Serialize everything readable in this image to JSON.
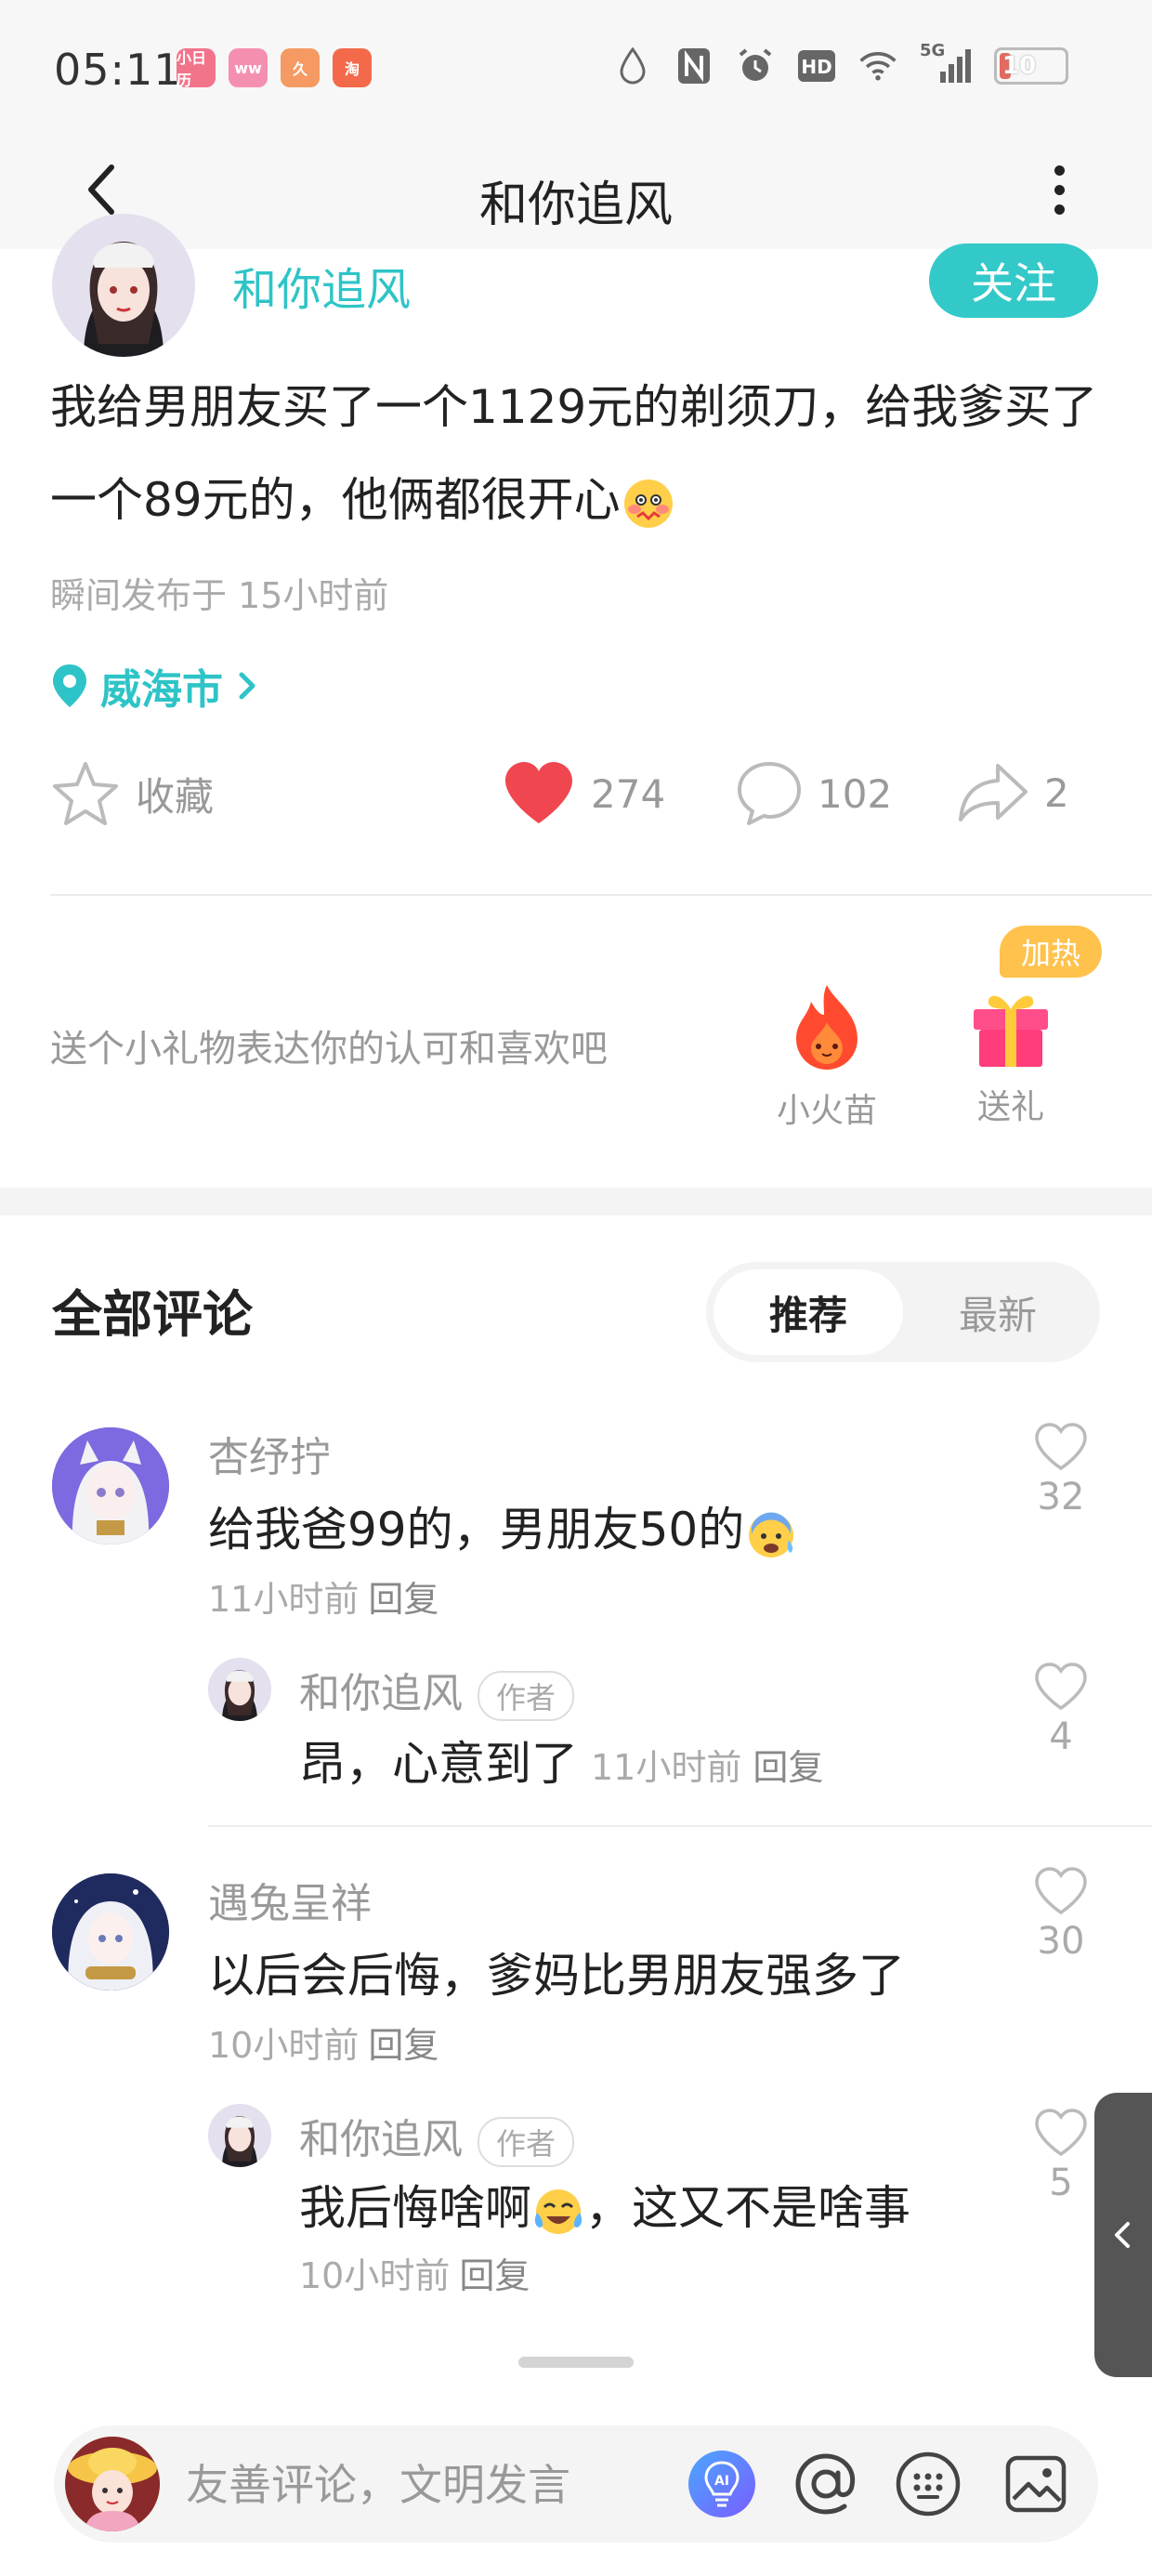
{
  "status_bar": {
    "time": "05:11",
    "apps": [
      {
        "label": "小日历",
        "color": "#f2748b"
      },
      {
        "label": "ww",
        "color": "#f58fb0"
      },
      {
        "label": "久",
        "color": "#f59a63"
      },
      {
        "label": "淘",
        "color": "#f3694a"
      }
    ],
    "network": "5G",
    "battery": "10"
  },
  "nav": {
    "title": "和你追风"
  },
  "post": {
    "author": "和你追风",
    "follow_label": "关注",
    "text": "我给男朋友买了一个1129元的剃须刀，给我爹买了一个89元的，他俩都很开心",
    "time": "瞬间发布于 15小时前",
    "location": "威海市"
  },
  "actions": {
    "favorite_label": "收藏",
    "likes": "274",
    "comments": "102",
    "shares": "2"
  },
  "gifts": {
    "prompt": "送个小礼物表达你的认可和喜欢吧",
    "fire_label": "小火苗",
    "gift_label": "送礼",
    "heat_badge": "加热"
  },
  "comments_section": {
    "title": "全部评论",
    "sort_options": [
      "推荐",
      "最新"
    ],
    "active_sort": "推荐"
  },
  "comments": [
    {
      "user": "杏纾拧",
      "text": "给我爸99的，男朋友50的",
      "time": "11小时前",
      "reply_label": "回复",
      "likes": "32",
      "reply": {
        "user": "和你追风",
        "tag": "作者",
        "text": "昂，心意到了",
        "time": "11小时前",
        "reply_label": "回复",
        "likes": "4"
      }
    },
    {
      "user": "遇兔呈祥",
      "text": "以后会后悔，爹妈比男朋友强多了",
      "time": "10小时前",
      "reply_label": "回复",
      "likes": "30",
      "reply": {
        "user": "和你追风",
        "tag": "作者",
        "text_before": "我后悔啥啊",
        "text_after": "，这又不是啥事",
        "time": "10小时前",
        "reply_label": "回复",
        "likes": "5"
      }
    }
  ],
  "input": {
    "placeholder": "友善评论，文明发言",
    "ai_label": "AI"
  },
  "colors": {
    "accent": "#2ec4c7",
    "like_red": "#f0464f",
    "heat_badge": "#ffc24d"
  }
}
